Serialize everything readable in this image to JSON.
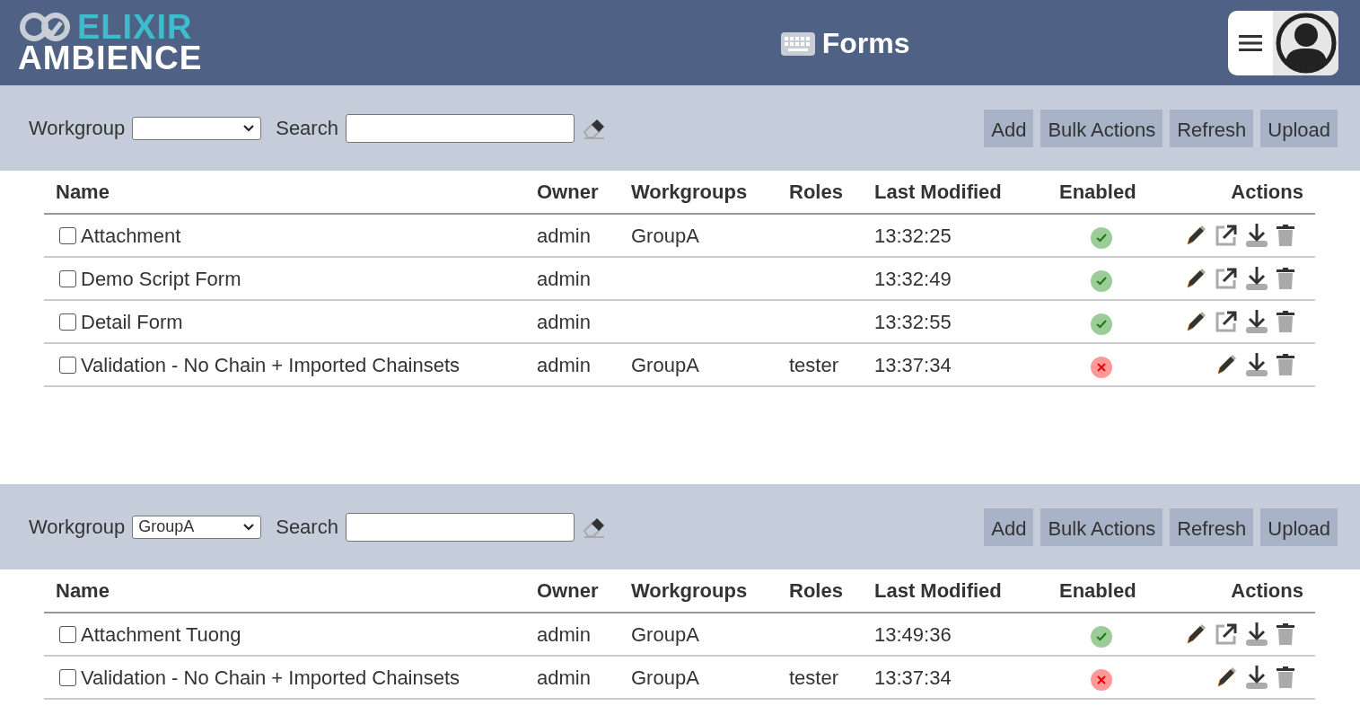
{
  "header": {
    "logo_top": "ELIXIR",
    "logo_bottom": "AMBIENCE",
    "title": "Forms"
  },
  "panels": [
    {
      "workgroup_label": "Workgroup",
      "search_label": "Search",
      "buttons": [
        "Add",
        "Bulk Actions",
        "Refresh",
        "Upload"
      ],
      "columns": [
        "Name",
        "Owner",
        "Workgroups",
        "Roles",
        "Last Modified",
        "Enabled",
        "Actions"
      ],
      "rows": [
        {
          "name": "Attachment",
          "checked": false,
          "owner": "admin",
          "workgroups": "GroupA",
          "last_modified": "13:32:25",
          "enabled": true,
          "actions": [
            {
              "kind": "edit"
            },
            {
              "kind": "open"
            },
            {
              "kind": "download"
            },
            {
              "kind": "delete"
            }
          ]
        },
        {
          "name": "Demo Script Form",
          "checked": false,
          "owner": "admin",
          "last_modified": "13:32:49",
          "enabled": true,
          "actions": [
            {
              "kind": "edit"
            },
            {
              "kind": "open"
            },
            {
              "kind": "download"
            },
            {
              "kind": "delete"
            }
          ]
        },
        {
          "name": "Detail Form",
          "checked": false,
          "owner": "admin",
          "last_modified": "13:32:55",
          "enabled": true,
          "actions": [
            {
              "kind": "edit"
            },
            {
              "kind": "open"
            },
            {
              "kind": "download"
            },
            {
              "kind": "delete"
            }
          ]
        },
        {
          "name": "Validation - No Chain + Imported Chainsets",
          "checked": false,
          "owner": "admin",
          "workgroups": "GroupA",
          "roles": "tester",
          "last_modified": "13:37:34",
          "enabled": false,
          "actions": [
            {
              "kind": "edit"
            },
            {
              "kind": "download"
            },
            {
              "kind": "delete"
            }
          ]
        }
      ]
    },
    {
      "workgroup_label": "Workgroup",
      "workgroup_value": "GroupA",
      "search_label": "Search",
      "buttons": [
        "Add",
        "Bulk Actions",
        "Refresh",
        "Upload"
      ],
      "columns": [
        "Name",
        "Owner",
        "Workgroups",
        "Roles",
        "Last Modified",
        "Enabled",
        "Actions"
      ],
      "rows": [
        {
          "name": "Attachment Tuong",
          "checked": false,
          "owner": "admin",
          "workgroups": "GroupA",
          "last_modified": "13:49:36",
          "enabled": true,
          "actions": [
            {
              "kind": "edit"
            },
            {
              "kind": "open"
            },
            {
              "kind": "download"
            },
            {
              "kind": "delete"
            }
          ]
        },
        {
          "name": "Validation - No Chain + Imported Chainsets",
          "checked": false,
          "owner": "admin",
          "workgroups": "GroupA",
          "roles": "tester",
          "last_modified": "13:37:34",
          "enabled": false,
          "actions": [
            {
              "kind": "edit"
            },
            {
              "kind": "download"
            },
            {
              "kind": "delete"
            }
          ]
        }
      ]
    }
  ]
}
